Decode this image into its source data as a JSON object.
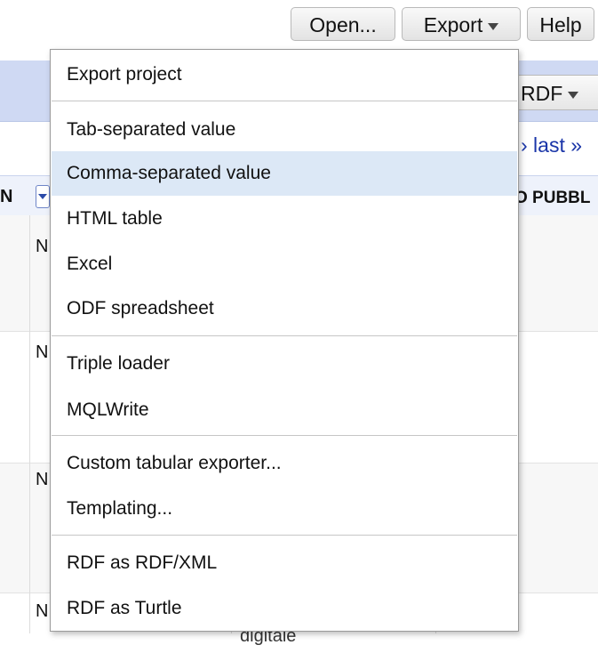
{
  "toolbar": {
    "open_label": "Open...",
    "export_label": "Export",
    "help_label": "Help"
  },
  "grid": {
    "rdf_button": "RDF",
    "pager_last": "› last »",
    "header_left": "N",
    "header_right": "O PUBBL",
    "row_labels": [
      "N",
      "N",
      "N",
      "N"
    ],
    "partial_cell": "digitale"
  },
  "export_menu": {
    "highlighted_index": 2,
    "groups": [
      [
        "Export project"
      ],
      [
        "Tab-separated value",
        "Comma-separated value",
        "HTML table",
        "Excel",
        "ODF spreadsheet"
      ],
      [
        "Triple loader",
        "MQLWrite"
      ],
      [
        "Custom tabular exporter...",
        "Templating..."
      ],
      [
        "RDF as RDF/XML",
        "RDF as Turtle"
      ]
    ],
    "items": {
      "export_project": "Export project",
      "tsv": "Tab-separated value",
      "csv": "Comma-separated value",
      "html_table": "HTML table",
      "excel": "Excel",
      "odf": "ODF spreadsheet",
      "triple_loader": "Triple loader",
      "mqlwrite": "MQLWrite",
      "custom_tabular": "Custom tabular exporter...",
      "templating": "Templating...",
      "rdf_xml": "RDF as RDF/XML",
      "rdf_turtle": "RDF as Turtle"
    }
  }
}
